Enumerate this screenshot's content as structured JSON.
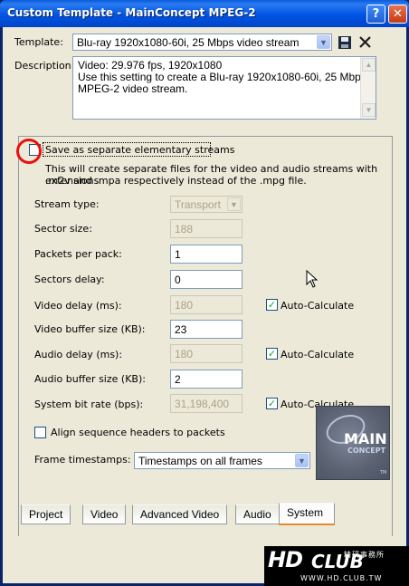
{
  "window": {
    "title": "Custom Template - MainConcept MPEG-2",
    "help_label": "?",
    "close_label": "✕"
  },
  "template": {
    "label": "Template:",
    "value": "Blu-ray 1920x1080-60i, 25 Mbps video stream",
    "save_icon": "floppy-disk-icon",
    "delete_icon": "x-delete-icon"
  },
  "description": {
    "label": "Description:",
    "lines": [
      "Video: 29.976 fps, 1920x1080",
      "Use this setting to create a Blu-ray 1920x1080-60i, 25 Mbps,",
      "MPEG-2 video stream."
    ]
  },
  "elementary": {
    "label": "Save as separate elementary streams",
    "checked": false,
    "help_line1": "This will create separate files for the video and audio streams with extensions",
    "help_line2": ".m2v and .mpa respectively instead of the .mpg file."
  },
  "settings": {
    "stream_type": {
      "label": "Stream type:",
      "value": "Transport"
    },
    "sector_size": {
      "label": "Sector size:",
      "value": "188"
    },
    "packets_per_pack": {
      "label": "Packets per pack:",
      "value": "1"
    },
    "sectors_delay": {
      "label": "Sectors delay:",
      "value": "0"
    },
    "video_delay": {
      "label": "Video delay (ms):",
      "value": "180",
      "auto_label": "Auto-Calculate",
      "auto_checked": true
    },
    "video_buffer": {
      "label": "Video buffer size (KB):",
      "value": "23"
    },
    "audio_delay": {
      "label": "Audio delay (ms):",
      "value": "180",
      "auto_label": "Auto-Calculate",
      "auto_checked": true
    },
    "audio_buffer": {
      "label": "Audio buffer size (KB):",
      "value": "2"
    },
    "system_bitrate": {
      "label": "System bit rate (bps):",
      "value": "31,198,400",
      "auto_label": "Auto-Calculate",
      "auto_checked": true
    }
  },
  "align": {
    "label": "Align sequence headers to packets",
    "checked": false
  },
  "frame_timestamps": {
    "label": "Frame timestamps:",
    "value": "Timestamps on all frames"
  },
  "mainconcept_logo": {
    "line1": "MAIN",
    "line2": "CONCEPT",
    "tm": "TM"
  },
  "tabs": [
    "Project",
    "Video",
    "Advanced Video",
    "Audio",
    "System"
  ],
  "active_tab": "System",
  "watermark": {
    "brand": "HD",
    "club": "CLUB",
    "chinese": "精研事務所",
    "url": "WWW.HD.CLUB.TW"
  },
  "colors": {
    "title_blue": "#0054e3",
    "annotation_red": "#e8110e",
    "check_green": "#21a121"
  }
}
